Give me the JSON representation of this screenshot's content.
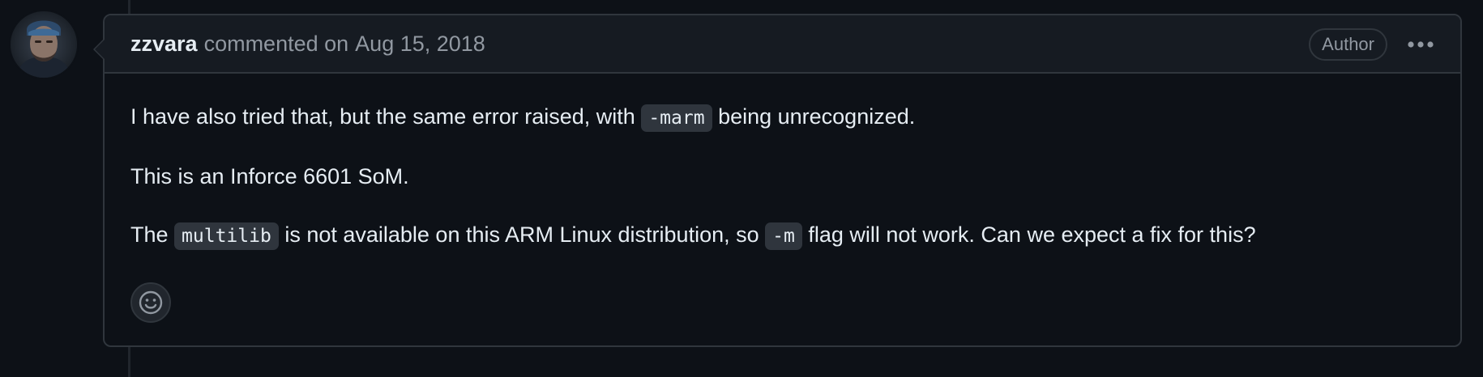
{
  "comment": {
    "author": "zzvara",
    "action": "commented on",
    "date": "Aug 15, 2018",
    "badge": "Author",
    "body": {
      "p1_before": "I have also tried that, but the same error raised, with ",
      "p1_code": "-marm",
      "p1_after": " being unrecognized.",
      "p2": "This is an Inforce 6601 SoM.",
      "p3_before": "The ",
      "p3_code1": "multilib",
      "p3_middle": " is not available on this ARM Linux distribution, so ",
      "p3_code2": "-m",
      "p3_after": " flag will not work. Can we expect a fix for this?"
    }
  },
  "icons": {
    "more": "kebab-horizontal-icon",
    "reaction": "smiley-icon",
    "avatar": "user-avatar"
  },
  "colors": {
    "background": "#0d1117",
    "header": "#161b22",
    "border": "#30363d",
    "code_bg": "#2f353d",
    "muted_text": "#9198a1",
    "text": "#e6edf3"
  }
}
